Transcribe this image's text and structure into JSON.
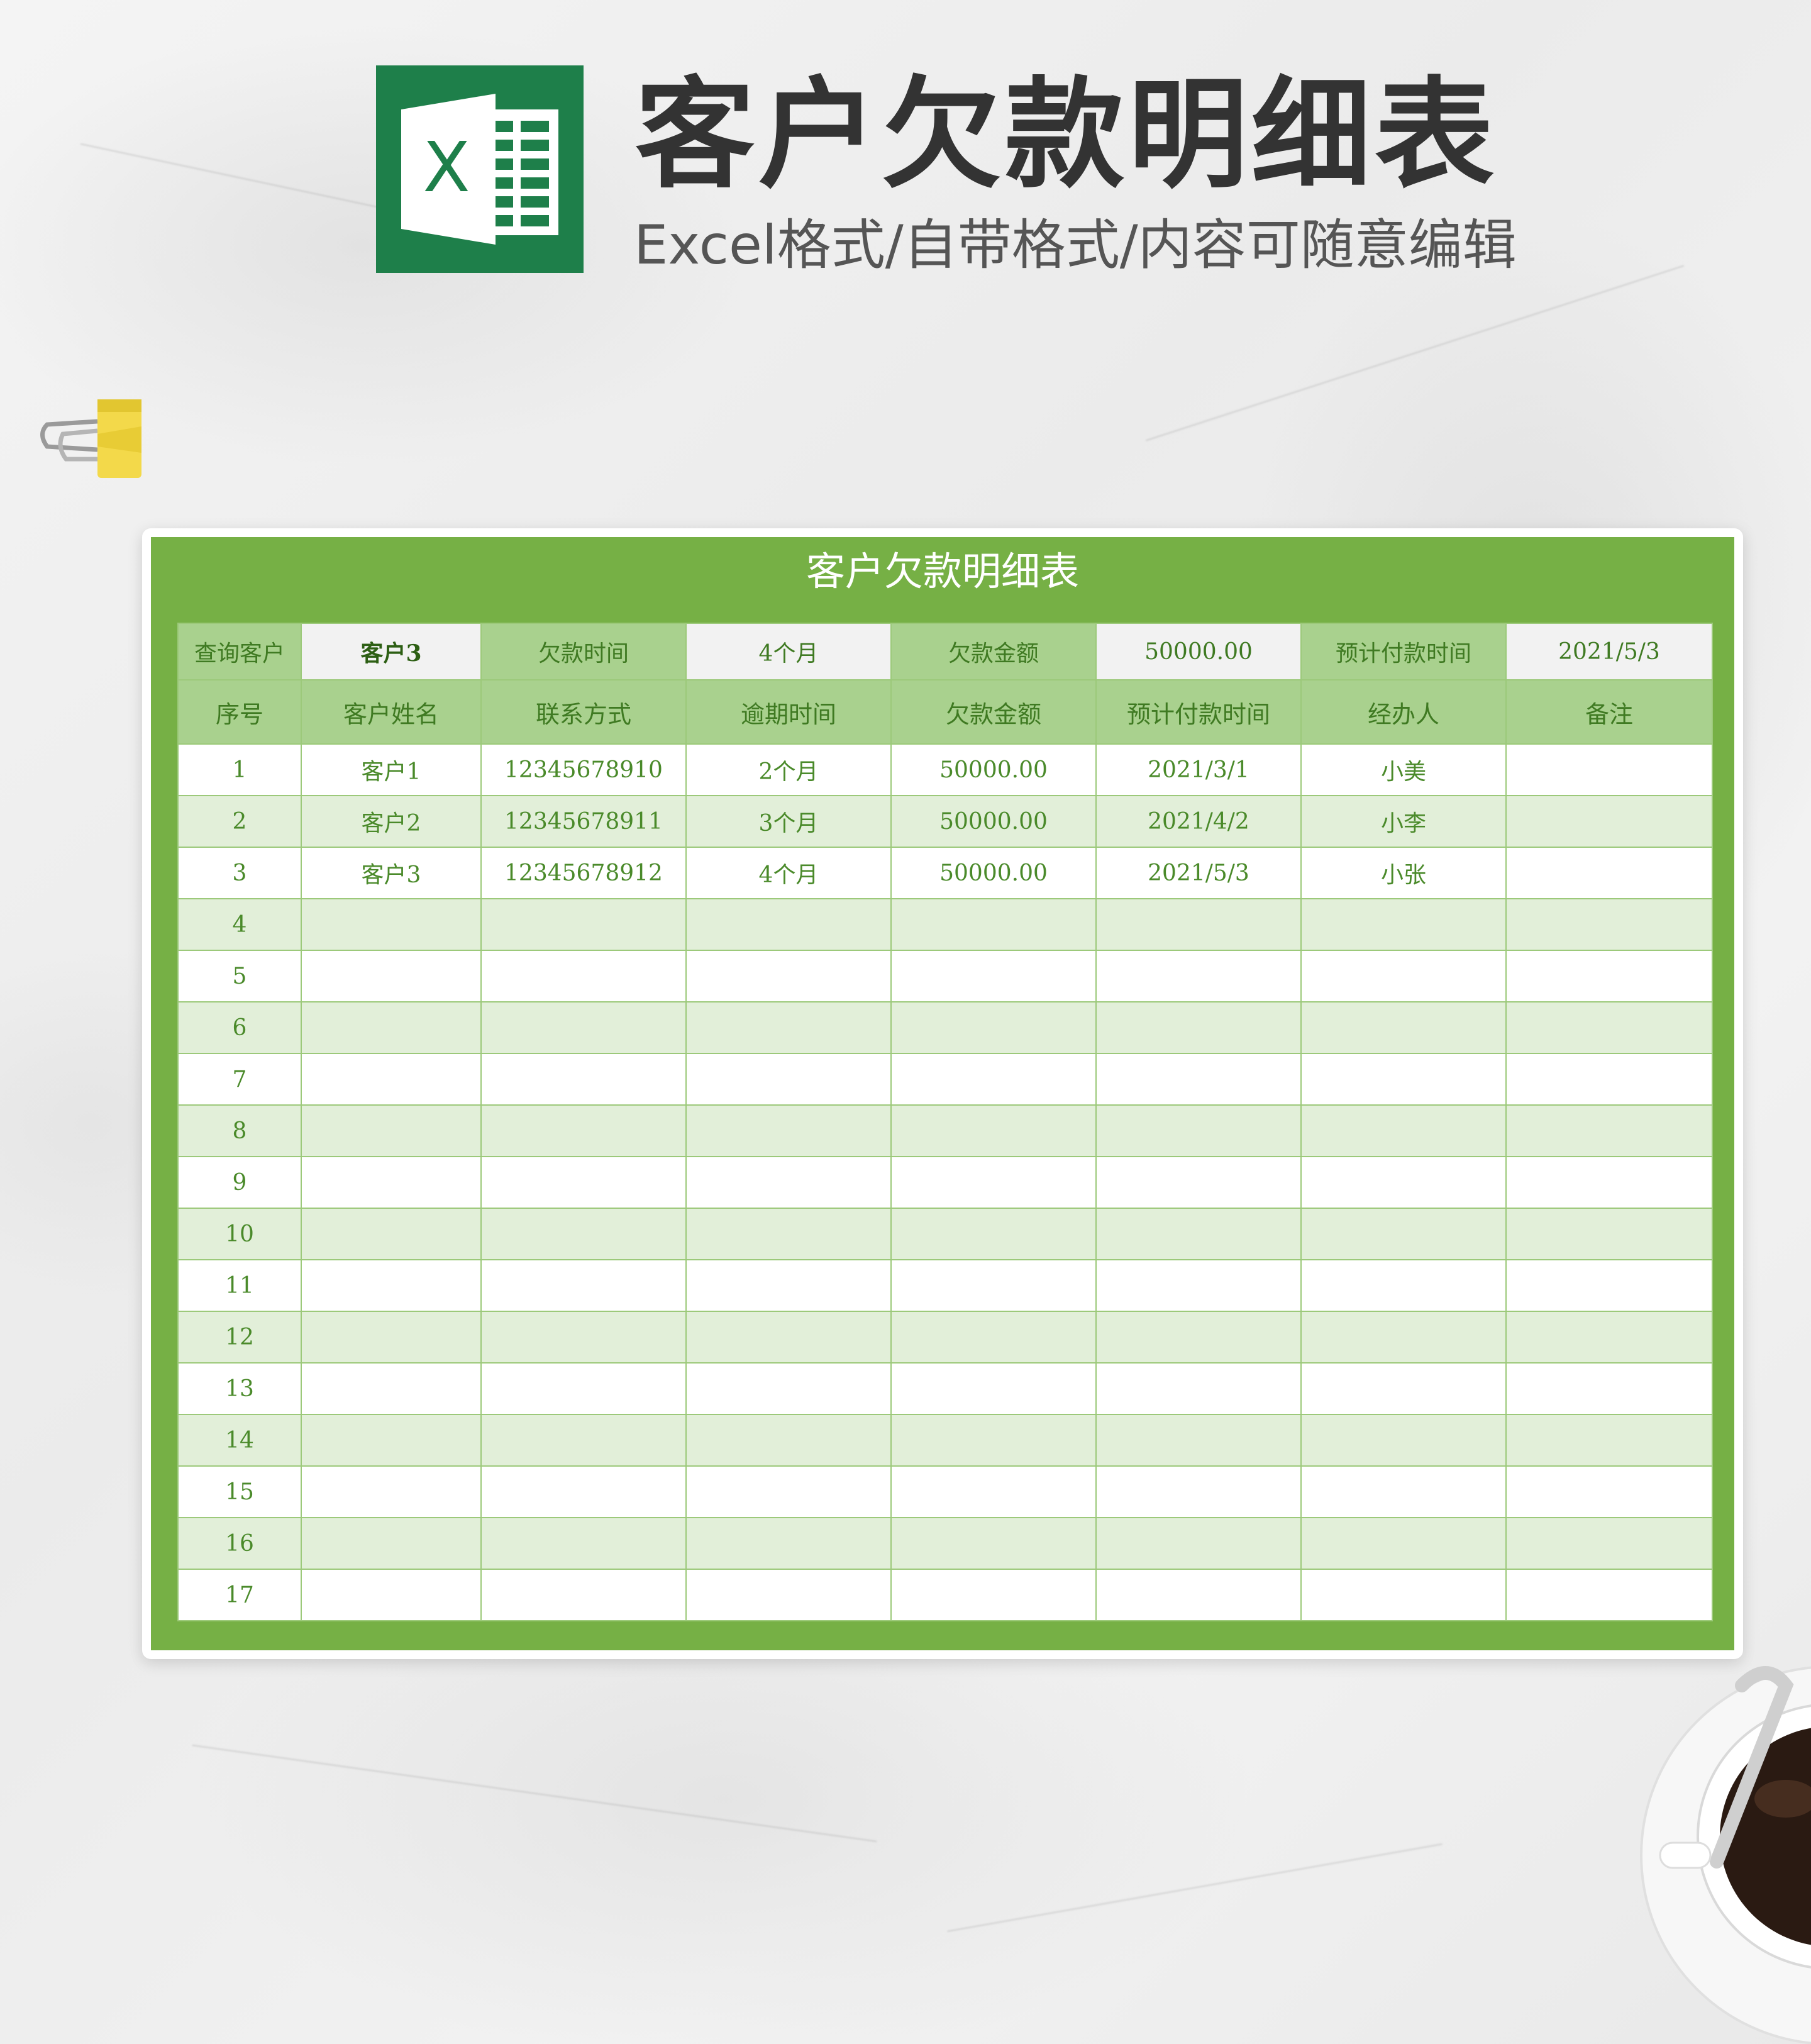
{
  "header": {
    "title": "客户欠款明细表",
    "subtitle": "Excel格式/自带格式/内容可随意编辑",
    "logo_letter": "X"
  },
  "sheet": {
    "title": "客户欠款明细表",
    "query": {
      "customer_label": "查询客户",
      "customer_value": "客户3",
      "debt_time_label": "欠款时间",
      "debt_time_value": "4个月",
      "amount_label": "欠款金额",
      "amount_value": "50000.00",
      "due_label": "预计付款时间",
      "due_value": "2021/5/3"
    },
    "columns": [
      "序号",
      "客户姓名",
      "联系方式",
      "逾期时间",
      "欠款金额",
      "预计付款时间",
      "经办人",
      "备注"
    ],
    "rows": [
      [
        "1",
        "客户1",
        "12345678910",
        "2个月",
        "50000.00",
        "2021/3/1",
        "小美",
        ""
      ],
      [
        "2",
        "客户2",
        "12345678911",
        "3个月",
        "50000.00",
        "2021/4/2",
        "小李",
        ""
      ],
      [
        "3",
        "客户3",
        "12345678912",
        "4个月",
        "50000.00",
        "2021/5/3",
        "小张",
        ""
      ],
      [
        "4",
        "",
        "",
        "",
        "",
        "",
        "",
        ""
      ],
      [
        "5",
        "",
        "",
        "",
        "",
        "",
        "",
        ""
      ],
      [
        "6",
        "",
        "",
        "",
        "",
        "",
        "",
        ""
      ],
      [
        "7",
        "",
        "",
        "",
        "",
        "",
        "",
        ""
      ],
      [
        "8",
        "",
        "",
        "",
        "",
        "",
        "",
        ""
      ],
      [
        "9",
        "",
        "",
        "",
        "",
        "",
        "",
        ""
      ],
      [
        "10",
        "",
        "",
        "",
        "",
        "",
        "",
        ""
      ],
      [
        "11",
        "",
        "",
        "",
        "",
        "",
        "",
        ""
      ],
      [
        "12",
        "",
        "",
        "",
        "",
        "",
        "",
        ""
      ],
      [
        "13",
        "",
        "",
        "",
        "",
        "",
        "",
        ""
      ],
      [
        "14",
        "",
        "",
        "",
        "",
        "",
        "",
        ""
      ],
      [
        "15",
        "",
        "",
        "",
        "",
        "",
        "",
        ""
      ],
      [
        "16",
        "",
        "",
        "",
        "",
        "",
        "",
        ""
      ],
      [
        "17",
        "",
        "",
        "",
        "",
        "",
        "",
        ""
      ]
    ]
  },
  "colors": {
    "sheet_green": "#76b045",
    "header_green": "#a9d18e",
    "stripe_green": "#e2efd9",
    "logo_green": "#1e7f4a"
  },
  "icons": {
    "logo": "excel-icon",
    "clip": "binder-clip-icon",
    "cup": "coffee-cup-icon"
  }
}
